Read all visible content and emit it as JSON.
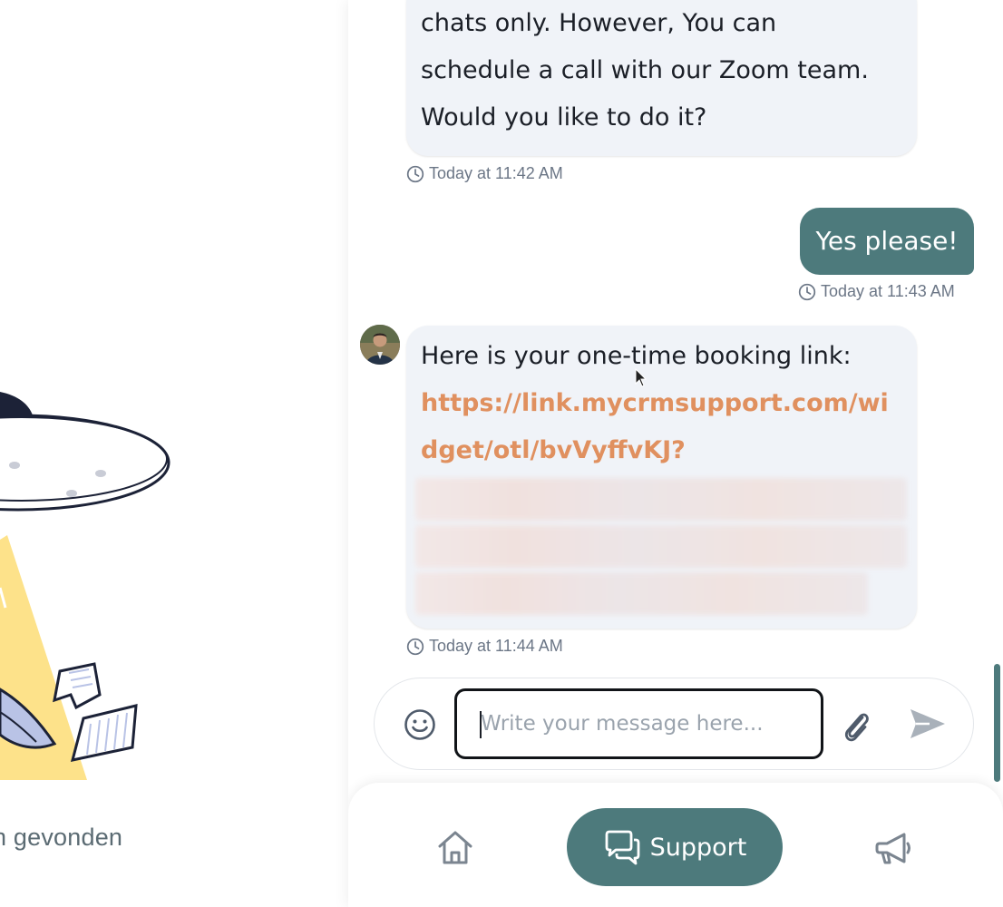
{
  "background": {
    "caption": "n gevonden"
  },
  "messages": [
    {
      "sender": "agent",
      "lines": [
        "chats only. However, You can",
        "schedule a call with our Zoom team.",
        "Would you like to do it?"
      ],
      "timestamp": "Today at 11:42 AM"
    },
    {
      "sender": "user",
      "text": "Yes please!",
      "timestamp": "Today at 11:43 AM"
    },
    {
      "sender": "agent",
      "intro": "Here is your one-time booking link:",
      "link": "https://link.mycrmsupport.com/widget/otl/bvVyffvKJ?",
      "timestamp": "Today at 11:44 AM"
    }
  ],
  "composer": {
    "placeholder": "Write your message here...",
    "value": ""
  },
  "nav": {
    "support_label": "Support"
  },
  "colors": {
    "accent": "#4d7a7c",
    "link": "#e0905f",
    "agent_bubble": "#f0f3f8",
    "timestamp": "#6b7686"
  },
  "icons": {
    "timestamp": "clock-icon",
    "emoji": "smiley-icon",
    "attach": "paperclip-icon",
    "send": "send-icon",
    "home": "home-icon",
    "support": "chat-bubbles-icon",
    "news": "megaphone-icon"
  }
}
